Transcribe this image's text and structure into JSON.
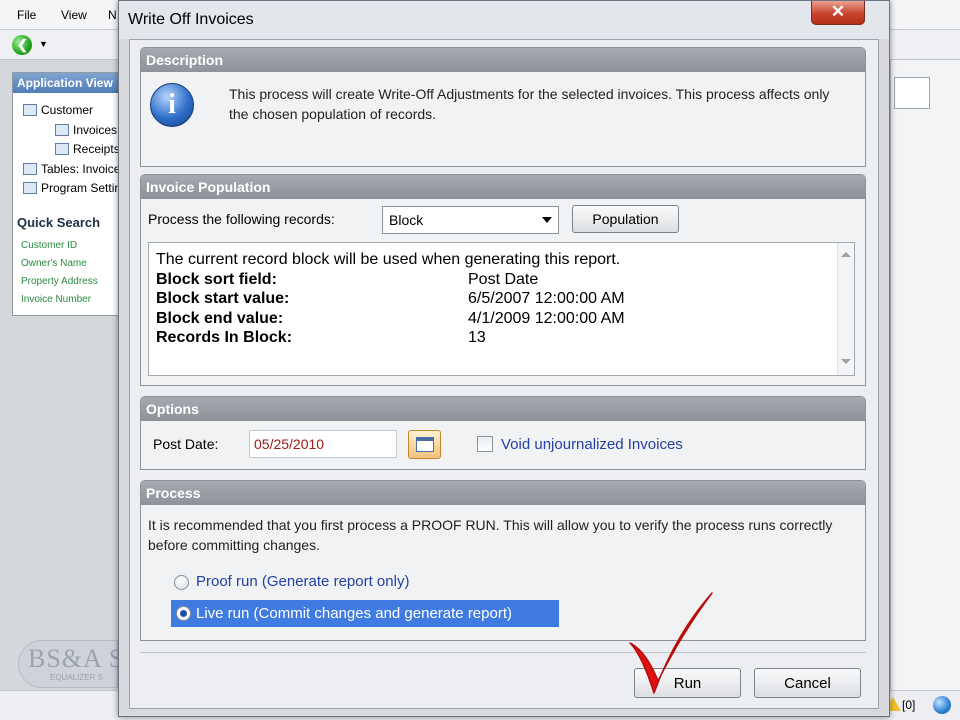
{
  "background_app": {
    "menu": [
      "File",
      "View",
      "N"
    ],
    "app_view_title": "Application View",
    "tree": [
      "Customer",
      "Invoices",
      "Receipts",
      "Tables: Invoices",
      "Program Settings"
    ],
    "quick_search_title": "Quick Search",
    "quick_search_links": [
      "Customer ID",
      "Owner's Name",
      "Property Address",
      "Invoice Number"
    ],
    "logo_text": "BS&A S",
    "logo_subtext": "EQUALIZER S",
    "status_count": "[0]"
  },
  "dialog": {
    "title": "Write Off Invoices",
    "close_glyph": "✕",
    "description": {
      "header": "Description",
      "icon_glyph": "i",
      "text": "This process will create Write-Off Adjustments for the selected invoices. This process affects only the chosen population of records."
    },
    "population": {
      "header": "Invoice Population",
      "label": "Process the following records:",
      "selected": "Block",
      "button": "Population",
      "intro": "The current record block will be used when generating this report.",
      "fields": [
        {
          "label": "Block sort field:",
          "value": "Post Date"
        },
        {
          "label": "Block start value:",
          "value": "6/5/2007 12:00:00 AM"
        },
        {
          "label": "Block end value:",
          "value": "4/1/2009 12:00:00 AM"
        },
        {
          "label": "Records In Block:",
          "value": "13"
        }
      ]
    },
    "options": {
      "header": "Options",
      "post_date_label": "Post Date:",
      "post_date_value": "05/25/2010",
      "void_label": "Void unjournalized Invoices",
      "void_checked": false
    },
    "process": {
      "header": "Process",
      "text": "It is recommended that you first process a PROOF RUN.  This will allow you to verify the process runs correctly before committing changes.",
      "proof_label": "Proof run (Generate report only)",
      "live_label": "Live run (Commit changes and generate report)",
      "selected": "live"
    },
    "buttons": {
      "run": "Run",
      "cancel": "Cancel"
    }
  },
  "colors": {
    "selection": "#3f7be0",
    "checkmark": "#e01010",
    "link_text": "#2340a4",
    "date_text": "#a11a1a"
  }
}
